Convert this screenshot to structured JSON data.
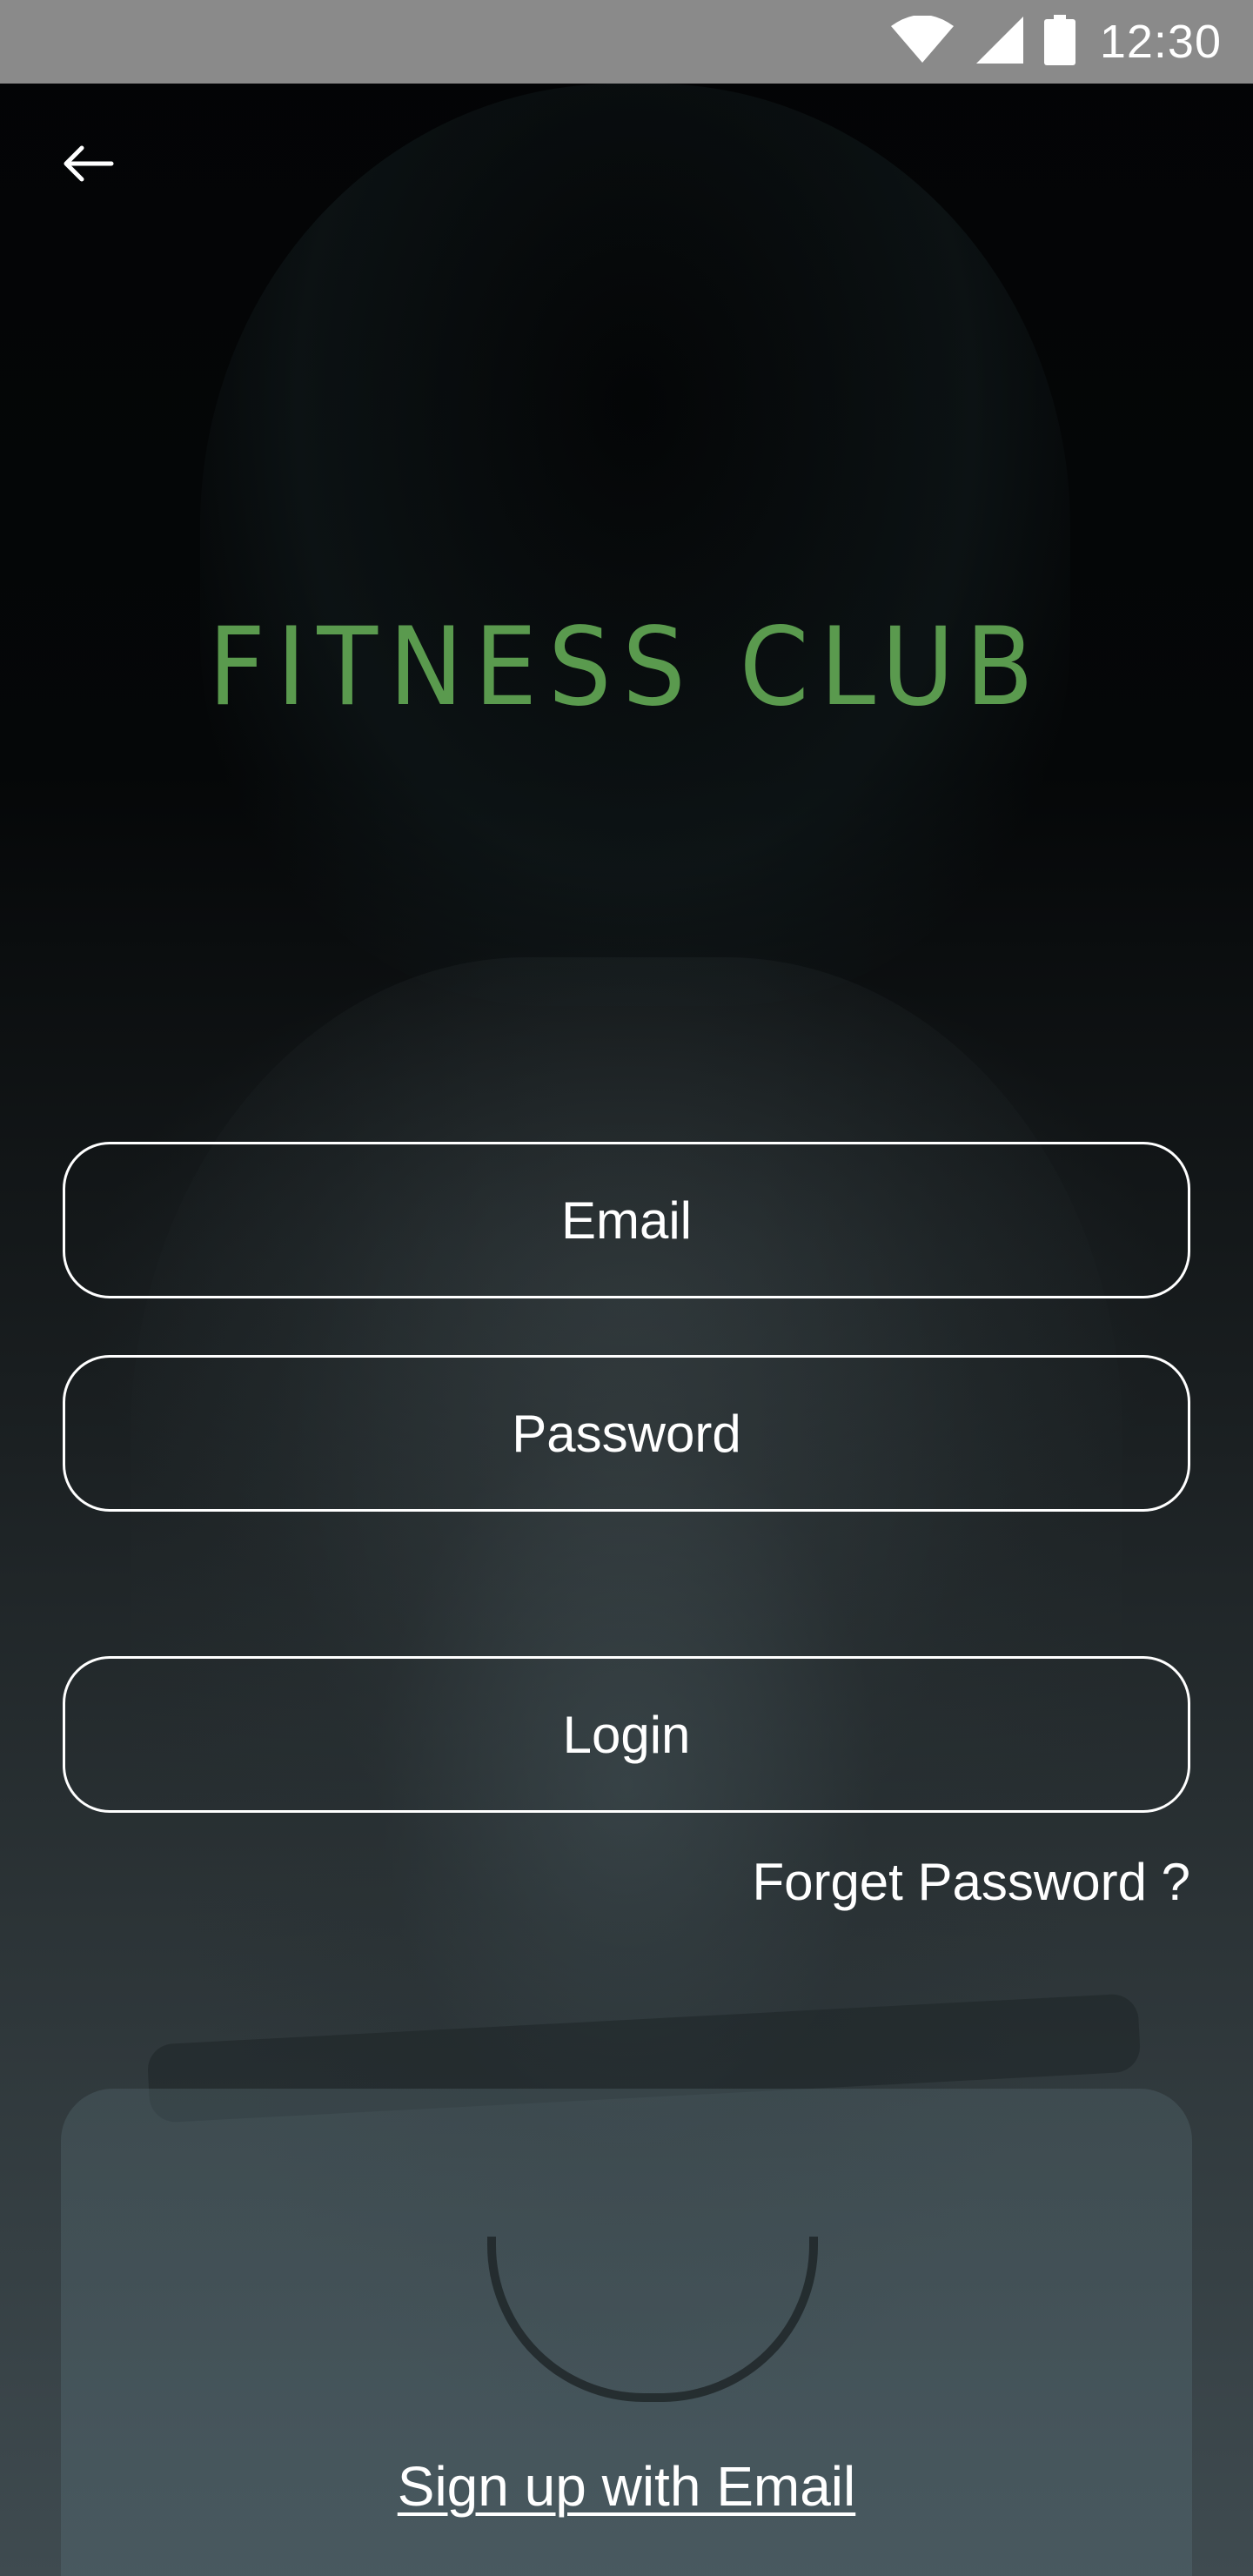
{
  "status_bar": {
    "time": "12:30",
    "icons": [
      "wifi-icon",
      "cellular-signal-icon",
      "battery-icon"
    ]
  },
  "header": {
    "back_icon": "arrow-left-icon"
  },
  "logo": {
    "text": "FITNESS CLUB",
    "color": "#5a9a4e"
  },
  "form": {
    "email_placeholder": "Email",
    "email_value": "",
    "password_placeholder": "Password",
    "password_value": "",
    "login_label": "Login",
    "forget_password_label": "Forget Password ?"
  },
  "footer": {
    "signup_label": "Sign up with Email"
  },
  "colors": {
    "accent": "#5a9a4e",
    "status_bar": "#8a8a8a",
    "text": "#ffffff"
  }
}
